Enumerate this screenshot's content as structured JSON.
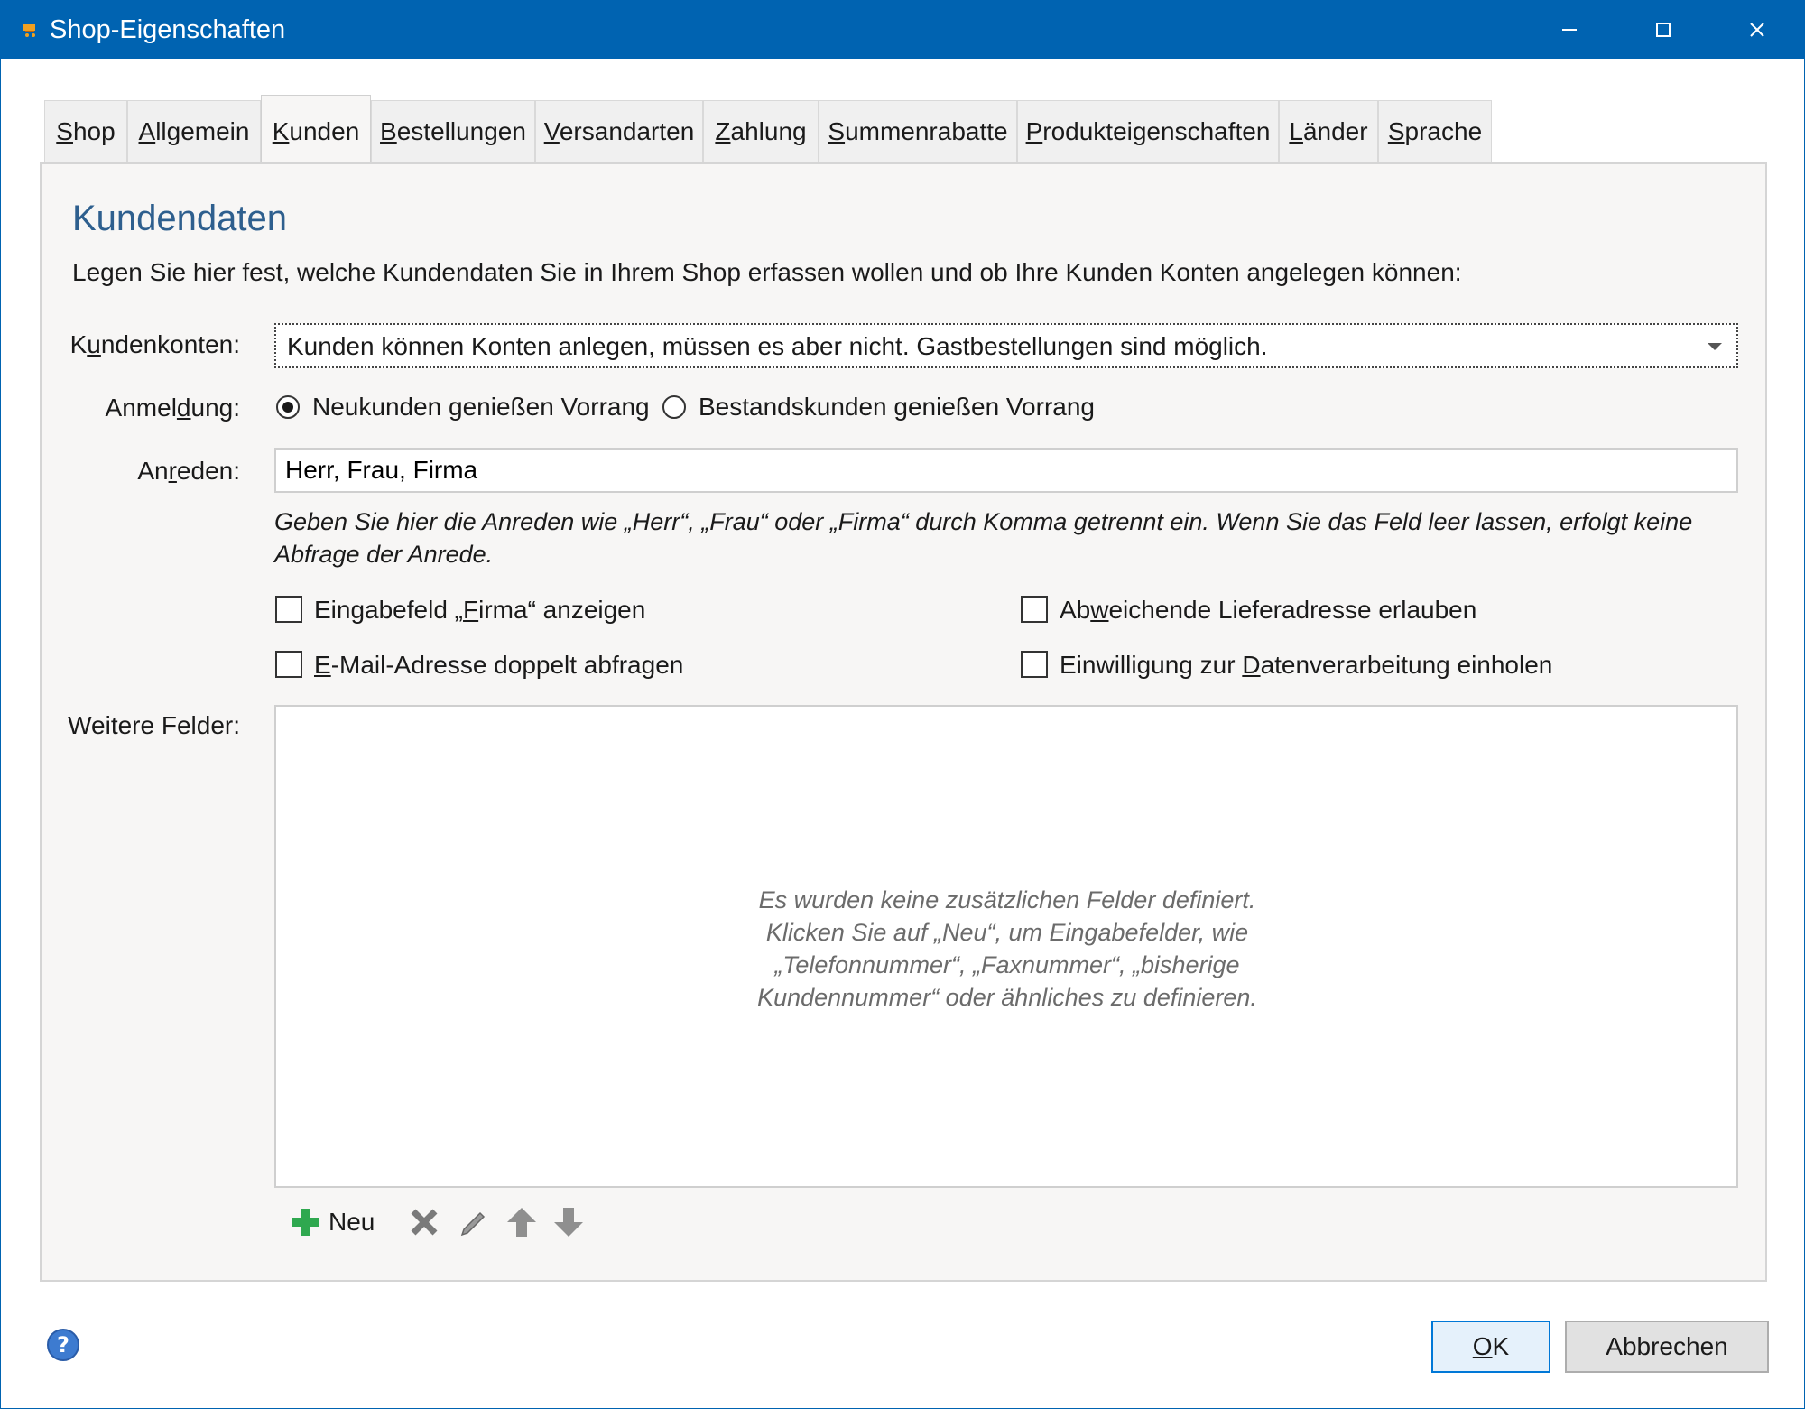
{
  "window": {
    "title": "Shop-Eigenschaften",
    "icon": "shop-cart-icon"
  },
  "tabs": [
    {
      "label": "Shop",
      "mnemonic": "S",
      "rest": "hop"
    },
    {
      "label": "Allgemein",
      "mnemonic": "A",
      "rest": "llgemein"
    },
    {
      "label": "Kunden",
      "mnemonic": "K",
      "rest": "unden",
      "active": true
    },
    {
      "label": "Bestellungen",
      "mnemonic": "B",
      "rest": "estellungen"
    },
    {
      "label": "Versandarten",
      "mnemonic": "V",
      "rest": "ersandarten"
    },
    {
      "label": "Zahlung",
      "mnemonic": "Z",
      "rest": "ahlung"
    },
    {
      "label": "Summenrabatte",
      "mnemonic": "S",
      "rest": "ummenrabatte"
    },
    {
      "label": "Produkteigenschaften",
      "mnemonic": "P",
      "rest": "rodukteigenschaften"
    },
    {
      "label": "Länder",
      "mnemonic": "L",
      "rest": "änder"
    },
    {
      "label": "Sprache",
      "mnemonic": "S",
      "rest": "prache"
    }
  ],
  "section": {
    "title": "Kundendaten",
    "intro": "Legen Sie hier fest, welche Kundendaten Sie in Ihrem Shop erfassen wollen und ob Ihre Kunden Konten angelegen können:"
  },
  "kundenkonten": {
    "label_pre": "K",
    "label_mn": "u",
    "label_post": "ndenkonten:",
    "value": "Kunden können Konten anlegen, müssen es aber nicht. Gastbestellungen sind möglich."
  },
  "anmeldung": {
    "label_pre": "Anmel",
    "label_mn": "d",
    "label_post": "ung:",
    "options": [
      {
        "label": "Neukunden genießen Vorrang",
        "selected": true
      },
      {
        "label": "Bestandskunden genießen Vorrang",
        "selected": false
      }
    ]
  },
  "anreden": {
    "label_pre": "An",
    "label_mn": "r",
    "label_post": "eden:",
    "value": "Herr, Frau, Firma",
    "hint": "Geben Sie hier die Anreden wie „Herr“, „Frau“ oder „Firma“ durch Komma getrennt ein. Wenn Sie das Feld leer lassen, erfolgt keine Abfrage der Anrede."
  },
  "checkboxes": {
    "firma": {
      "pre": "Eingabefeld „",
      "mn": "F",
      "post": "irma“ anzeigen",
      "checked": false
    },
    "email": {
      "pre": "",
      "mn": "E",
      "post": "-Mail-Adresse doppelt abfragen",
      "checked": false
    },
    "lieferadresse": {
      "pre": "Ab",
      "mn": "w",
      "post": "eichende Lieferadresse erlauben",
      "checked": false
    },
    "datenverarbeitung": {
      "pre": "Einwilligung zur ",
      "mn": "D",
      "post": "atenverarbeitung einholen",
      "checked": false
    }
  },
  "weitere_felder": {
    "label": "Weitere Felder:",
    "empty_message": "Es wurden keine zusätzlichen Felder definiert. Klicken Sie auf „Neu“, um Eingabefelder, wie „Telefonnummer“, „Faxnummer“, „bisherige Kundennummer“ oder ähnliches zu definieren."
  },
  "toolbar": {
    "new_label": "Neu",
    "icons": [
      "plus-icon",
      "delete-icon",
      "edit-pencil-icon",
      "arrow-up-icon",
      "arrow-down-icon"
    ]
  },
  "footer": {
    "ok_mn": "O",
    "ok_post": "K",
    "cancel_label": "Abbrechen",
    "help_icon": "help-icon"
  },
  "colors": {
    "titlebar": "#0063b1",
    "section_title": "#2e5f8e",
    "plus_green": "#2fa84f"
  }
}
